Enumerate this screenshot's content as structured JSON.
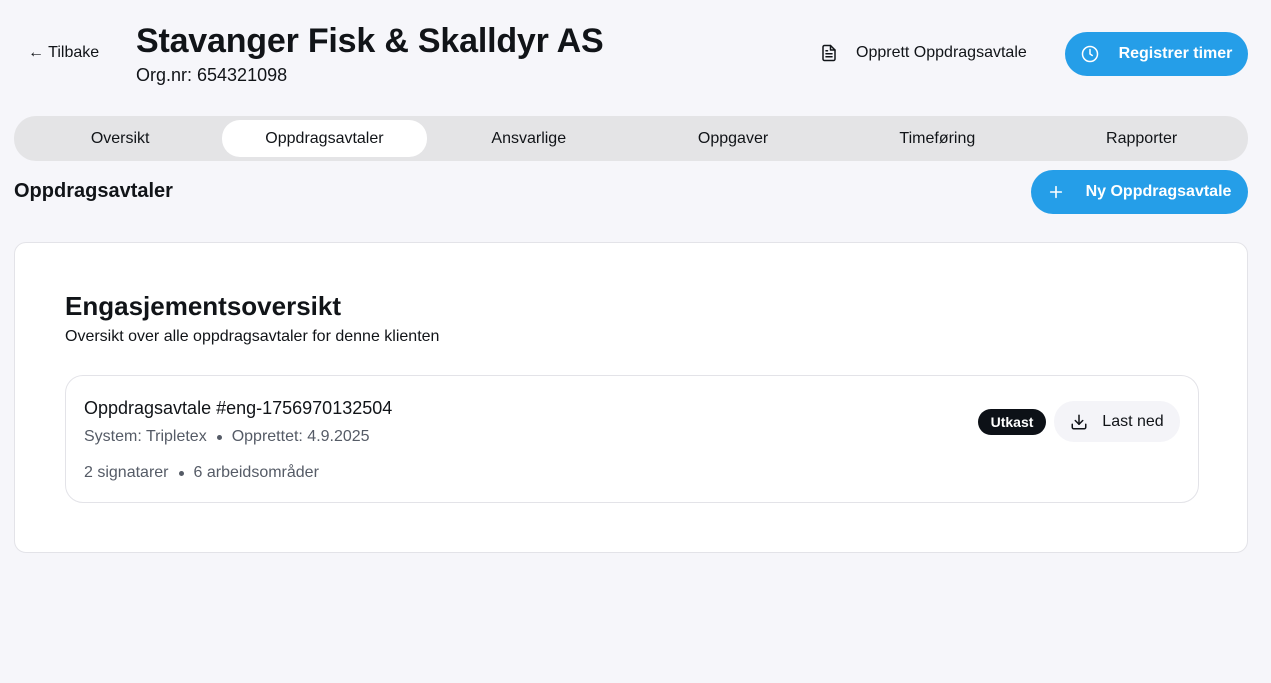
{
  "header": {
    "back_label": "← Tilbake",
    "title": "Stavanger Fisk & Skalldyr AS",
    "org_nr": "Org.nr: 654321098",
    "create_agreement_label": "Opprett Oppdragsavtale",
    "register_hours_label": "Registrer timer"
  },
  "tabs": [
    {
      "label": "Oversikt",
      "active": false
    },
    {
      "label": "Oppdragsavtaler",
      "active": true
    },
    {
      "label": "Ansvarlige",
      "active": false
    },
    {
      "label": "Oppgaver",
      "active": false
    },
    {
      "label": "Timeføring",
      "active": false
    },
    {
      "label": "Rapporter",
      "active": false
    }
  ],
  "section": {
    "title": "Oppdragsavtaler",
    "new_button_label": "Ny Oppdragsavtale"
  },
  "card": {
    "title": "Engasjementsoversikt",
    "subtitle": "Oversikt over alle oppdragsavtaler for denne klienten",
    "agreements": [
      {
        "title": "Oppdragsavtale #eng-1756970132504",
        "system": "System: Tripletex",
        "created": "Opprettet: 4.9.2025",
        "signers": "2 signatarer",
        "work_areas": "6 arbeidsområder",
        "status": "Utkast",
        "download_label": "Last ned"
      }
    ]
  },
  "colors": {
    "accent": "#259ee8",
    "background": "#f6f6fa",
    "badge": "#0d1117"
  },
  "icons": {
    "document": "document-icon",
    "clock": "clock-icon",
    "plus": "plus-icon",
    "download": "download-icon"
  }
}
